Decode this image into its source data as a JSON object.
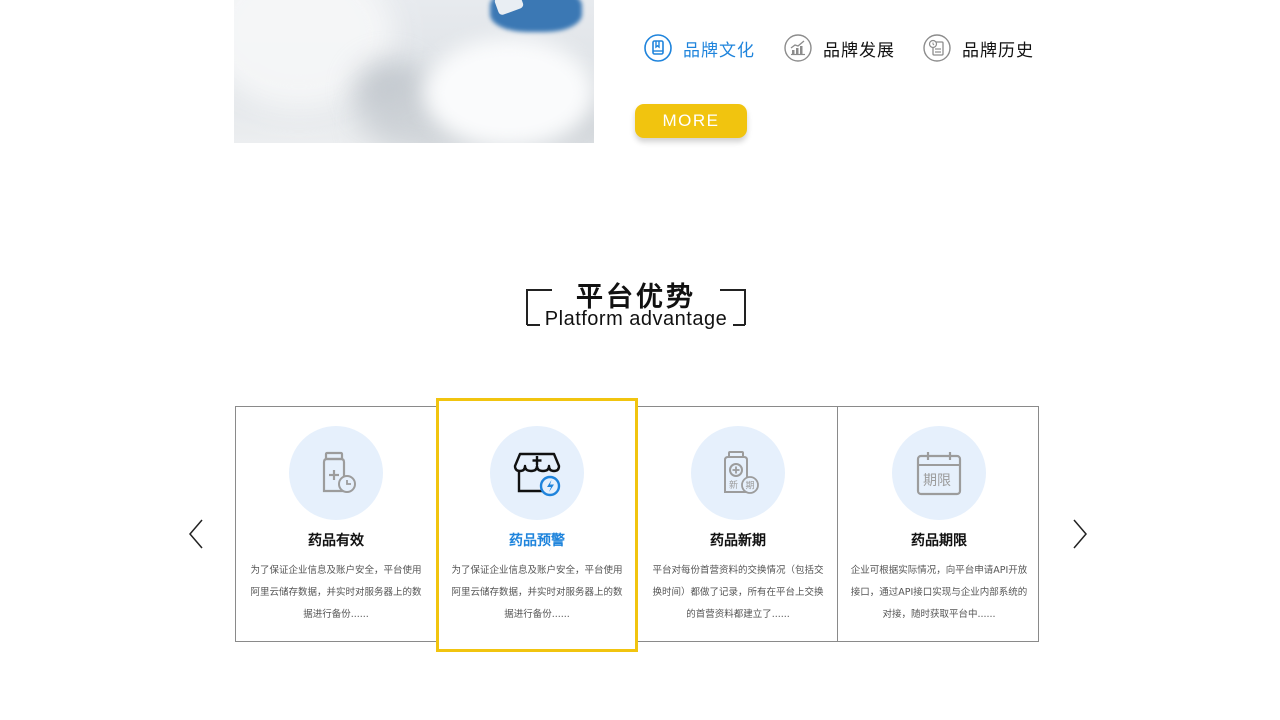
{
  "brand_tabs": [
    {
      "label": "品牌文化",
      "icon": "book-icon",
      "active": true
    },
    {
      "label": "品牌发展",
      "icon": "growth-chart-icon",
      "active": false
    },
    {
      "label": "品牌历史",
      "icon": "history-document-icon",
      "active": false
    }
  ],
  "more_button": "MORE",
  "section": {
    "title": "平台优势",
    "subtitle": "Platform advantage"
  },
  "cards": [
    {
      "title": "药品有效",
      "icon": "medicine-bottle-clock-icon",
      "description": "为了保证企业信息及账户安全，平台使用阿里云储存数据，并实时对服务器上的数据进行备份......"
    },
    {
      "title": "药品预警",
      "icon": "pharmacy-alert-icon",
      "description": "为了保证企业信息及账户安全，平台使用阿里云储存数据，并实时对服务器上的数据进行备份......",
      "highlighted": true
    },
    {
      "title": "药品新期",
      "icon": "medicine-new-period-icon",
      "description": "平台对每份首营资料的交换情况（包括交换时间）都做了记录，所有在平台上交换的首营资料都建立了......"
    },
    {
      "title": "药品期限",
      "icon": "calendar-expiry-icon",
      "description": "企业可根据实际情况，向平台申请API开放接口，通过API接口实现与企业内部系统的对接，随时获取平台中......"
    }
  ],
  "icon_text": {
    "new": "新",
    "period": "期",
    "deadline": "期限"
  },
  "colors": {
    "accent_blue": "#1f84dc",
    "accent_yellow": "#f1c40f",
    "icon_bg": "#e6f0fc",
    "border": "#8a8a8a"
  }
}
